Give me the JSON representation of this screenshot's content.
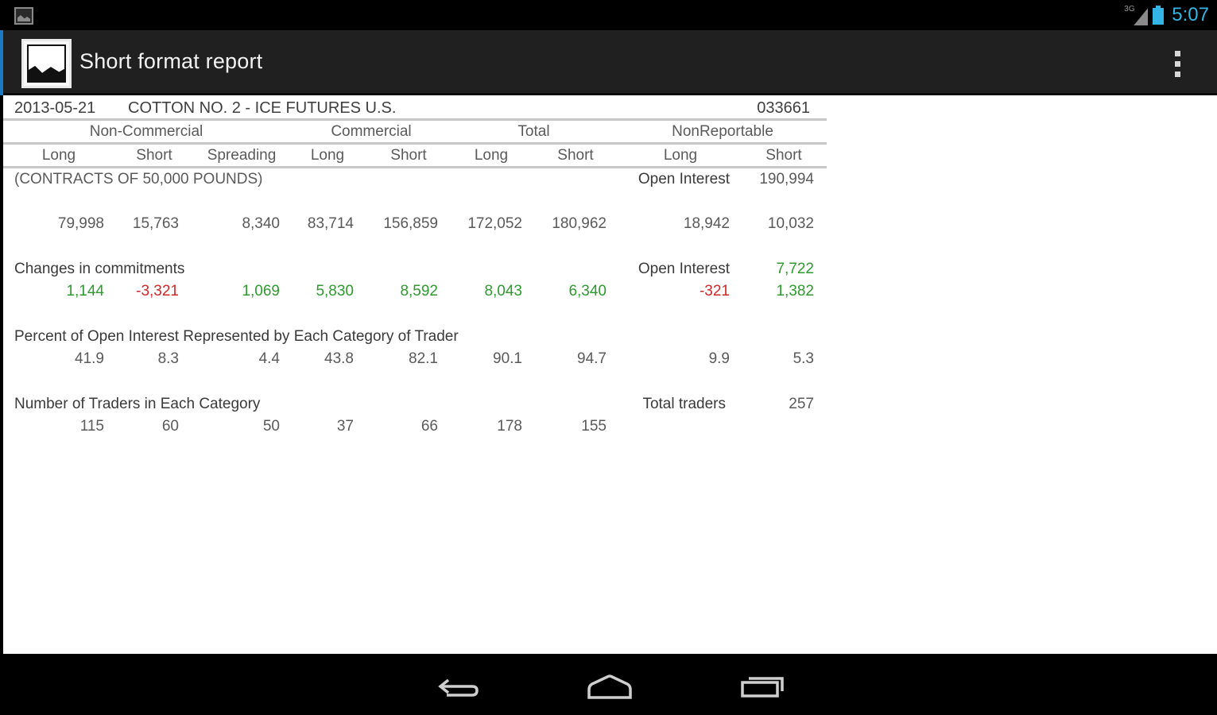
{
  "status": {
    "time": "5:07",
    "network_label": "3G",
    "icons": [
      "image-notification-icon",
      "signal-icon",
      "battery-icon"
    ]
  },
  "toolbar": {
    "title": "Short format report",
    "icons": [
      "app-image-icon",
      "overflow-menu-icon"
    ]
  },
  "report": {
    "date": "2013-05-21",
    "market": "COTTON NO. 2 - ICE FUTURES U.S.",
    "code": "033661",
    "groups": [
      "Non-Commercial",
      "Commercial",
      "Total",
      "NonReportable"
    ],
    "columns": [
      "Long",
      "Short",
      "Spreading",
      "Long",
      "Short",
      "Long",
      "Short",
      "Long",
      "Short"
    ],
    "units": "(CONTRACTS OF 50,000 POUNDS)",
    "open_interest_label": "Open Interest",
    "open_interest_value": "190,994",
    "positions": [
      "79,998",
      "15,763",
      "8,340",
      "83,714",
      "156,859",
      "172,052",
      "180,962",
      "18,942",
      "10,032"
    ],
    "changes": {
      "title": "Changes in commitments",
      "open_interest_label": "Open Interest",
      "open_interest_value": "7,722",
      "values": [
        "1,144",
        "-3,321",
        "1,069",
        "5,830",
        "8,592",
        "8,043",
        "6,340",
        "-321",
        "1,382"
      ]
    },
    "percent": {
      "title": "Percent of Open Interest Represented by Each Category of Trader",
      "values": [
        "41.9",
        "8.3",
        "4.4",
        "43.8",
        "82.1",
        "90.1",
        "94.7",
        "9.9",
        "5.3"
      ]
    },
    "traders": {
      "title": "Number of Traders in Each Category",
      "total_label": "Total traders",
      "total_value": "257",
      "values": [
        "115",
        "60",
        "50",
        "37",
        "66",
        "178",
        "155"
      ]
    }
  },
  "navigation": {
    "items": [
      "back-icon",
      "home-icon",
      "recent-apps-icon"
    ]
  },
  "colors": {
    "accent": "#33b5e5",
    "positive": "#2e9a2e",
    "negative": "#d02828",
    "action_bar": "#202020"
  }
}
